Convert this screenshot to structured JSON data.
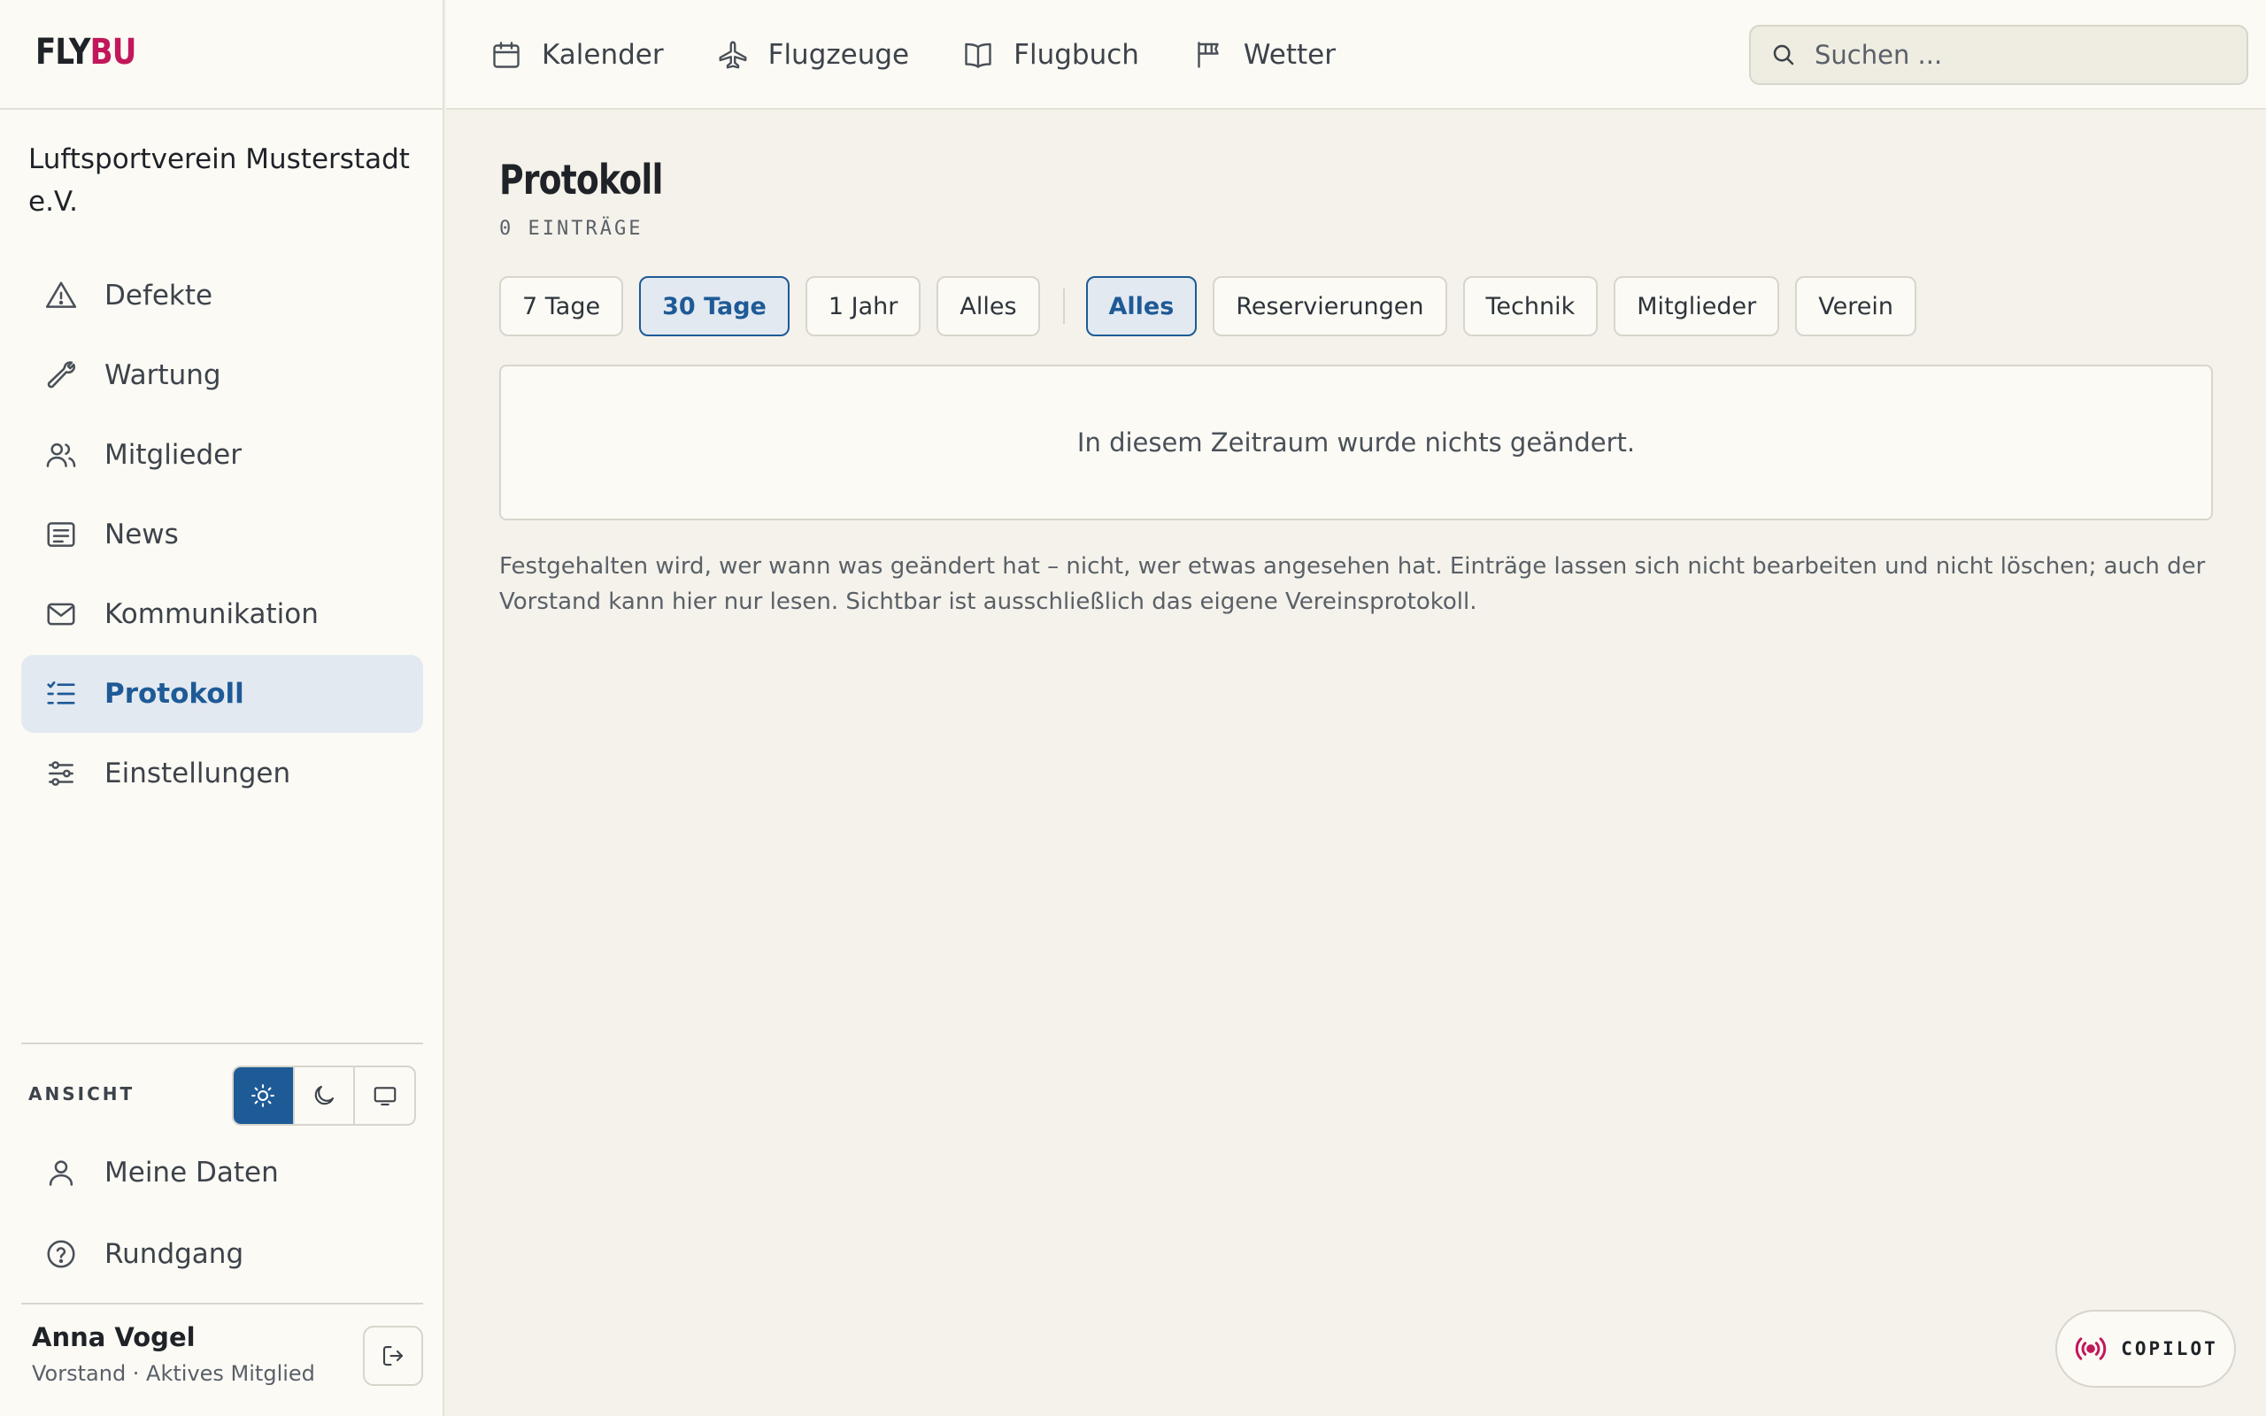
{
  "app": {
    "logo_main": "FLY",
    "logo_accent": "BU",
    "club_name": "Luftsportverein Musterstadt e.V."
  },
  "topnav": [
    {
      "label": "Kalender",
      "icon": "calendar-icon"
    },
    {
      "label": "Flugzeuge",
      "icon": "plane-icon"
    },
    {
      "label": "Flugbuch",
      "icon": "book-icon"
    },
    {
      "label": "Wetter",
      "icon": "windsock-icon"
    }
  ],
  "search": {
    "placeholder": "Suchen ..."
  },
  "sidebar": {
    "items": [
      {
        "label": "Defekte",
        "icon": "warning-icon"
      },
      {
        "label": "Wartung",
        "icon": "wrench-icon"
      },
      {
        "label": "Mitglieder",
        "icon": "users-icon"
      },
      {
        "label": "News",
        "icon": "newspaper-icon"
      },
      {
        "label": "Kommunikation",
        "icon": "mail-icon"
      },
      {
        "label": "Protokoll",
        "icon": "list-check-icon",
        "active": true
      },
      {
        "label": "Einstellungen",
        "icon": "sliders-icon"
      }
    ],
    "view_label": "ANSICHT",
    "theme_options": [
      "light",
      "dark",
      "system"
    ],
    "theme_selected": "light",
    "bottom_items": [
      {
        "label": "Meine Daten",
        "icon": "user-icon"
      },
      {
        "label": "Rundgang",
        "icon": "help-circle-icon"
      }
    ],
    "user": {
      "name": "Anna Vogel",
      "role": "Vorstand · Aktives Mitglied"
    }
  },
  "main": {
    "title": "Protokoll",
    "entry_count": "0 EINTRÄGE",
    "time_filters": [
      {
        "label": "7 Tage",
        "active": false
      },
      {
        "label": "30 Tage",
        "active": true
      },
      {
        "label": "1 Jahr",
        "active": false
      },
      {
        "label": "Alles",
        "active": false
      }
    ],
    "category_filters": [
      {
        "label": "Alles",
        "active": true
      },
      {
        "label": "Reservierungen",
        "active": false
      },
      {
        "label": "Technik",
        "active": false
      },
      {
        "label": "Mitglieder",
        "active": false
      },
      {
        "label": "Verein",
        "active": false
      }
    ],
    "empty_message": "In diesem Zeitraum wurde nichts geändert.",
    "info_text": "Festgehalten wird, wer wann was geändert hat – nicht, wer etwas angesehen hat. Einträge lassen sich nicht bearbeiten und nicht löschen; auch der Vorstand kann hier nur lesen. Sichtbar ist ausschließlich das eigene Vereinsprotokoll."
  },
  "copilot": {
    "label": "COPILOT"
  },
  "colors": {
    "accent": "#1e5a96",
    "brand": "#c2185b",
    "background": "#f4f2ea",
    "surface": "#fbfaf5"
  }
}
